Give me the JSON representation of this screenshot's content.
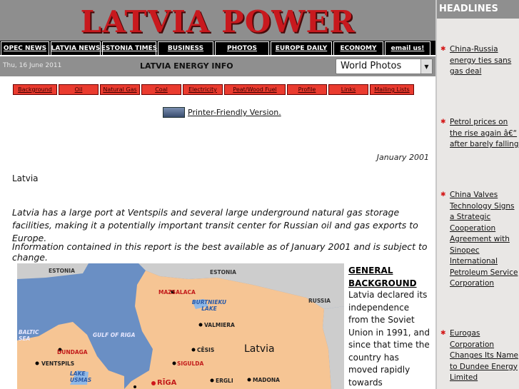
{
  "banner": {
    "title": "LATVIA POWER"
  },
  "nav": {
    "items": [
      "OPEC NEWS",
      "LATVIA NEWS",
      "ESTONIA TIMES",
      "BUSINESS",
      "PHOTOS",
      "EUROPE DAILY",
      "ECONOMY",
      "email us!"
    ]
  },
  "infobar": {
    "date": "Thu, 16 June 2011",
    "section": "LATVIA ENERGY INFO",
    "select_value": "World Photos"
  },
  "submenu": {
    "items": [
      "Background",
      "Oil",
      "Natural Gas",
      "Coal",
      "Electricity",
      "Peat/Wood Fuel",
      "Profile",
      "Links",
      "Mailing Lists"
    ]
  },
  "printer": {
    "label": "Printer-Friendly Version."
  },
  "report": {
    "date": "January 2001",
    "country": "Latvia",
    "intro": "Latvia has a large port at Ventspils and several large underground natural gas storage facilities, making it a potentially important transit center for Russian oil and gas exports to Europe.",
    "disclaimer": "Information contained in this report is the best available as of January 2001 and is subject to change."
  },
  "map": {
    "labels": [
      "ESTONIA",
      "ESTONIA",
      "MAZSALACA",
      "BURTNIEKU LAKE",
      "RUSSIA",
      "BALTIC SEA",
      "GULF OF RIGA",
      "VALMIERA",
      "DUNDAGA",
      "CĒSIS",
      "Latvia",
      "VENTSPILS",
      "LAKE USMAS",
      "SIGULDA",
      "RĪGA",
      "ERGLI",
      "MADONA"
    ]
  },
  "general_background": {
    "title": "GENERAL BACKGROUND",
    "text": "Latvia declared its independence from the Soviet Union in 1991, and since that time the country has moved rapidly towards integration with"
  },
  "sidebar": {
    "title": "HEADLINES",
    "headlines": [
      "China-Russia energy ties sans gas deal",
      "Petrol prices on the rise again â€“ after barely falling",
      "China Valves Technology Signs a Strategic Cooperation Agreement with Sinopec International Petroleum Service Corporation",
      "Eurogas Corporation Changes Its Name to Dundee Energy Limited"
    ]
  },
  "colors": {
    "banner_red": "#c8191e",
    "submenu_red": "#ea3b2f",
    "map_land": "#f6c594",
    "map_sea": "#6a8fc4"
  }
}
